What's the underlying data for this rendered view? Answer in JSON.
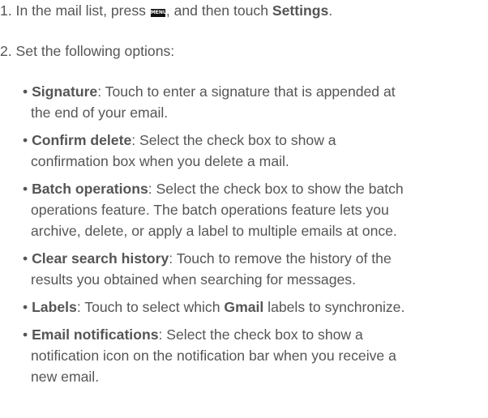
{
  "step1": {
    "prefix": "1. In the mail list, press ",
    "key_label": "MENU",
    "middle": ", and then touch ",
    "bold": "Settings",
    "suffix": "."
  },
  "step2": {
    "text": "2. Set the following options:"
  },
  "options": [
    {
      "term": "Signature",
      "lines": [
        ": Touch to enter a signature that is appended at",
        "the end of your email."
      ]
    },
    {
      "term": "Confirm delete",
      "lines": [
        ": Select the check box to show a",
        "confirmation box when you delete a mail."
      ]
    },
    {
      "term": "Batch operations",
      "lines": [
        ": Select the check box to show the batch",
        "operations feature. The batch operations feature lets you",
        "archive, delete, or apply a label to multiple emails at once."
      ]
    },
    {
      "term": "Clear search history",
      "lines": [
        ": Touch to remove the history of the",
        "results you obtained when searching for messages."
      ]
    },
    {
      "term": "Labels",
      "lines": [
        ": Touch to select which ",
        "labels to synchronize."
      ],
      "bold2": "Gmail"
    },
    {
      "term": "Email notifications",
      "lines": [
        ": Select the check box to show a",
        "notification icon on the notification bar when you receive a",
        "new email."
      ]
    }
  ]
}
